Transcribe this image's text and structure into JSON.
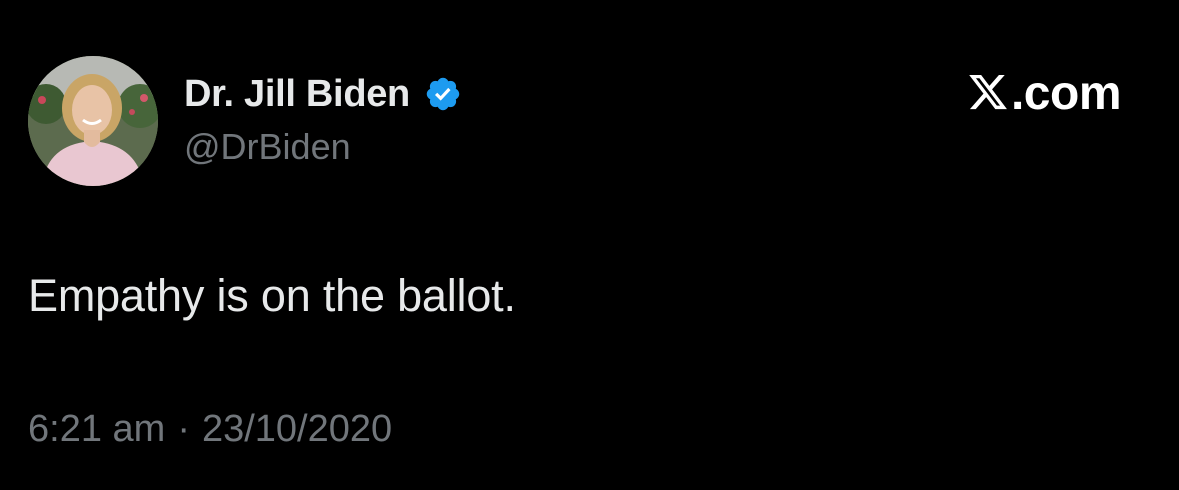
{
  "author": {
    "display_name": "Dr. Jill Biden",
    "handle": "@DrBiden",
    "verified_icon": "verified-badge-icon",
    "avatar_icon": "profile-photo"
  },
  "brand": {
    "logo_icon": "x-logo-icon",
    "label": ".com"
  },
  "tweet": {
    "text": "Empathy is on the ballot.",
    "time": "6:21 am",
    "separator": "·",
    "date": "23/10/2020"
  },
  "colors": {
    "background": "#000000",
    "primary_text": "#e7e9ea",
    "secondary_text": "#71767b",
    "verified_blue": "#1d9bf0"
  }
}
